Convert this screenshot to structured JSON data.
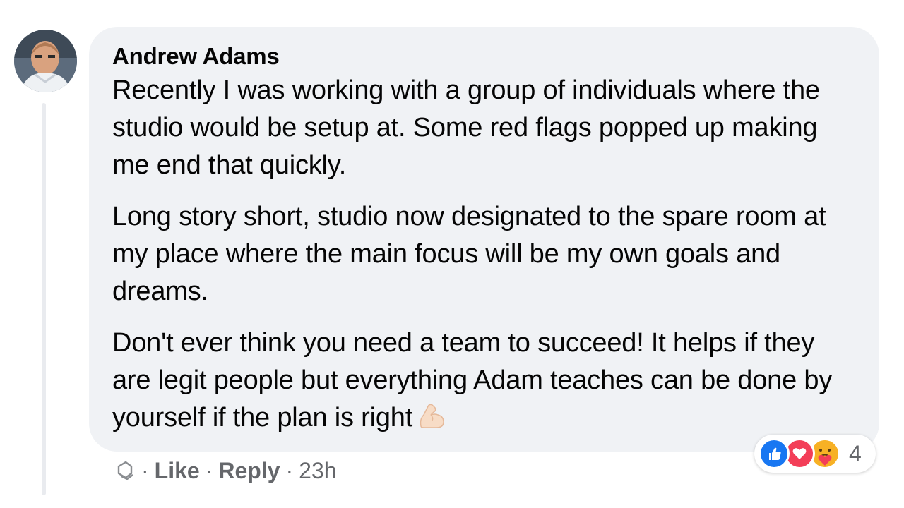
{
  "comment": {
    "author": "Andrew Adams",
    "paragraphs": [
      "Recently I was working with a group of individuals where the studio would be setup at. Some red flags popped up making me end that quickly.",
      "Long story short, studio now designated to the spare room at my place where the main focus will be my own goals and dreams.",
      "Don't ever think you need a team to succeed! It helps if they are legit people but everything Adam teaches can be done by yourself if the plan is right"
    ],
    "trailing_emoji": "flexed-biceps-emoji"
  },
  "actions": {
    "separator": "·",
    "like_label": "Like",
    "reply_label": "Reply",
    "timestamp": "23h"
  },
  "reactions": {
    "types": [
      "like",
      "love",
      "care"
    ],
    "count": "4"
  },
  "colors": {
    "bubble": "#f0f2f5",
    "text": "#050505",
    "meta": "#65676b",
    "like": "#1877f2",
    "love": "#f33e58",
    "care": "#f7b125"
  }
}
